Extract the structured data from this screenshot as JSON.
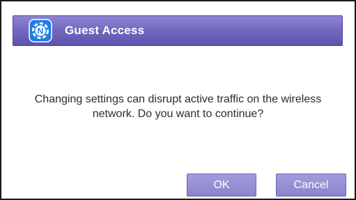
{
  "dialog": {
    "title": "Guest Access",
    "logo_icon": "netgear-n-icon",
    "message_line1": "Changing settings can disrupt active traffic on the wireless",
    "message_line2": "network. Do you want to continue?",
    "ok_label": "OK",
    "cancel_label": "Cancel"
  },
  "colors": {
    "titlebar": "#6f66bd",
    "button": "#8c84cc",
    "logo": "#1f7ee6",
    "text": "#2b2b2b"
  }
}
